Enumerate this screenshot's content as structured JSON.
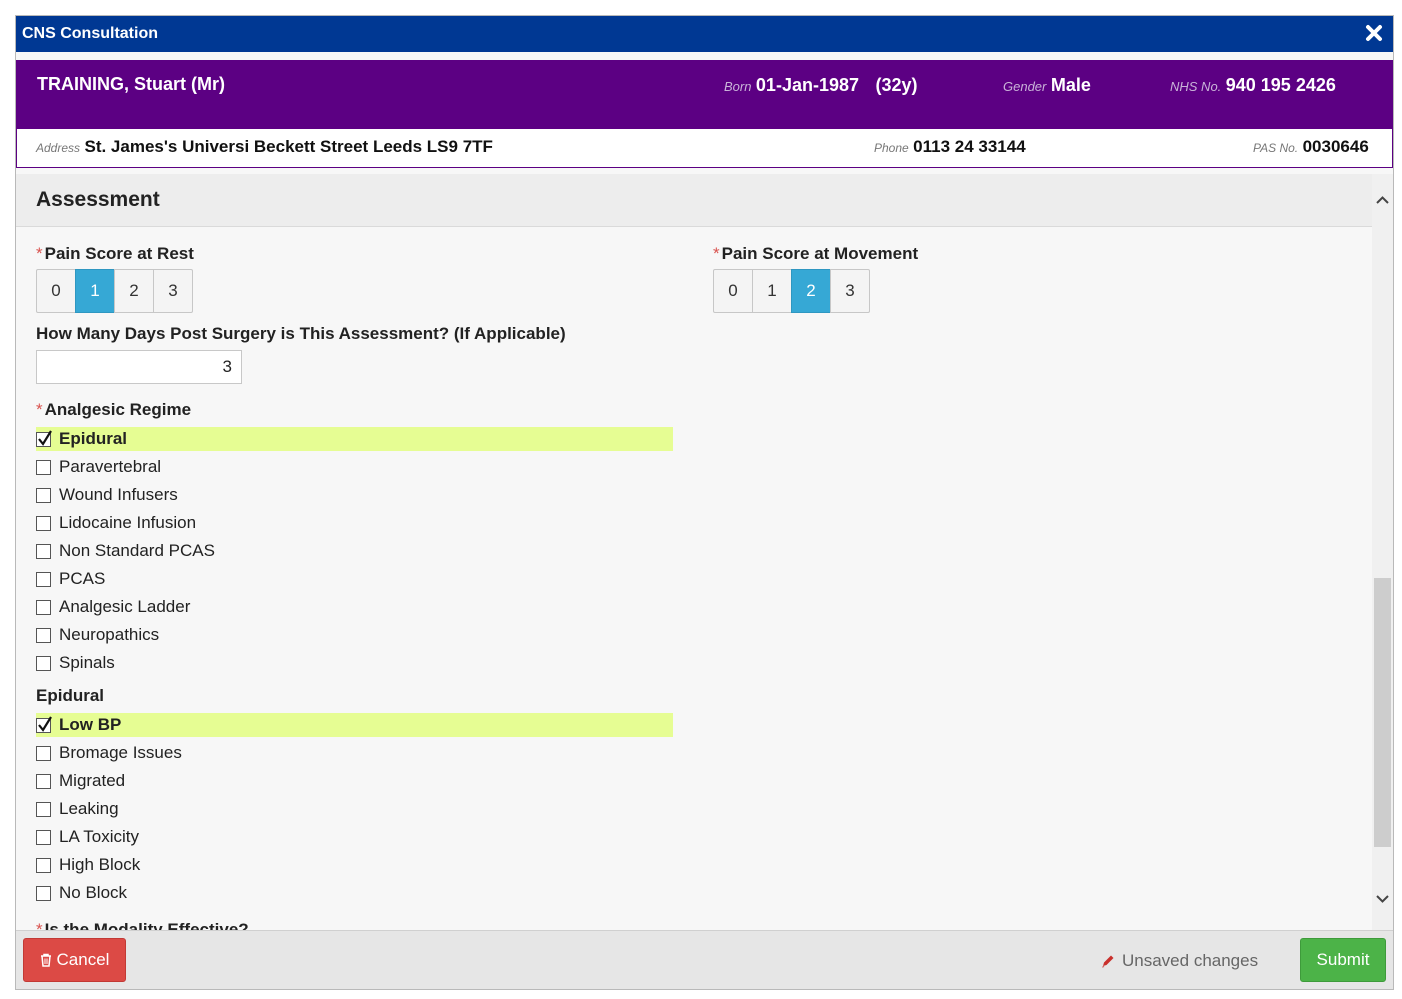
{
  "dialog": {
    "title": "CNS Consultation",
    "close_icon": "close-icon"
  },
  "patient": {
    "name": "TRAINING, Stuart (Mr)",
    "born_label": "Born",
    "born_value": "01-Jan-1987",
    "age": "(32y)",
    "gender_label": "Gender",
    "gender_value": "Male",
    "nhs_label": "NHS No.",
    "nhs_value": "940 195 2426",
    "address_label": "Address",
    "address_value": "St. James's Universi Beckett Street Leeds LS9 7TF",
    "phone_label": "Phone",
    "phone_value": "0113 24 33144",
    "pas_label": "PAS No.",
    "pas_value": "0030646"
  },
  "section": {
    "title": "Assessment"
  },
  "pain_rest": {
    "label": "Pain Score at Rest",
    "options": [
      "0",
      "1",
      "2",
      "3"
    ],
    "selected": "1"
  },
  "pain_movement": {
    "label": "Pain Score at Movement",
    "options": [
      "0",
      "1",
      "2",
      "3"
    ],
    "selected": "2"
  },
  "days_post": {
    "label": "How Many Days Post Surgery is This Assessment? (If Applicable)",
    "value": "3"
  },
  "analgesic": {
    "label": "Analgesic Regime",
    "items": [
      {
        "label": "Epidural",
        "checked": true
      },
      {
        "label": "Paravertebral",
        "checked": false
      },
      {
        "label": "Wound Infusers",
        "checked": false
      },
      {
        "label": "Lidocaine Infusion",
        "checked": false
      },
      {
        "label": "Non Standard PCAS",
        "checked": false
      },
      {
        "label": "PCAS",
        "checked": false
      },
      {
        "label": "Analgesic Ladder",
        "checked": false
      },
      {
        "label": "Neuropathics",
        "checked": false
      },
      {
        "label": "Spinals",
        "checked": false
      }
    ]
  },
  "epidural": {
    "label": "Epidural",
    "items": [
      {
        "label": "Low BP",
        "checked": true
      },
      {
        "label": "Bromage Issues",
        "checked": false
      },
      {
        "label": "Migrated",
        "checked": false
      },
      {
        "label": "Leaking",
        "checked": false
      },
      {
        "label": "LA Toxicity",
        "checked": false
      },
      {
        "label": "High Block",
        "checked": false
      },
      {
        "label": "No Block",
        "checked": false
      }
    ]
  },
  "next_question": {
    "label": "Is the Modality Effective?"
  },
  "footer": {
    "cancel_label": "Cancel",
    "unsaved_label": "Unsaved changes",
    "submit_label": "Submit"
  },
  "colors": {
    "title_bar": "#003893",
    "patient_banner": "#5c0083",
    "selected_button": "#36a8d5",
    "highlight": "#e6fd93",
    "cancel": "#dc4a45",
    "submit": "#4cb348"
  }
}
